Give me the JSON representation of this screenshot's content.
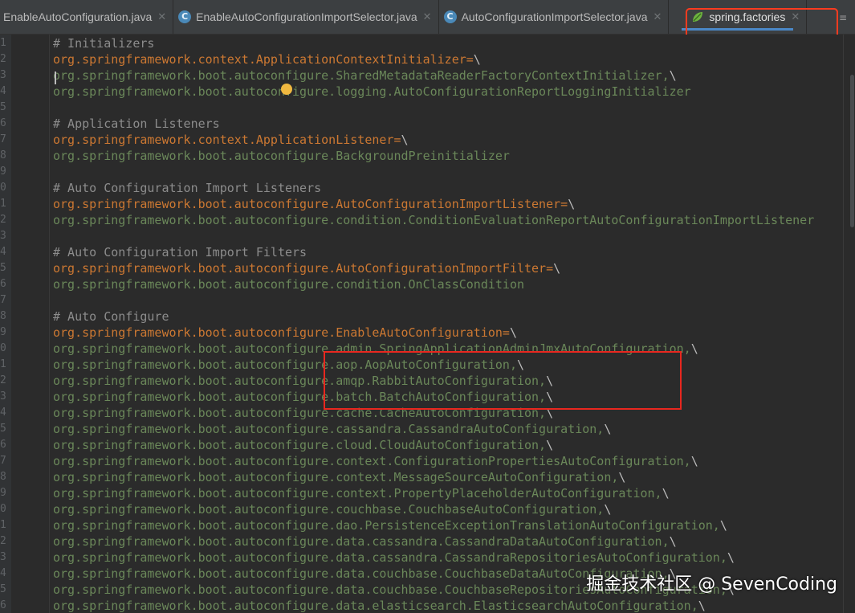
{
  "tabs": [
    {
      "label": "EnableAutoConfiguration.java",
      "icon": "java-class-icon",
      "active": false
    },
    {
      "label": "EnableAutoConfigurationImportSelector.java",
      "icon": "java-class-icon",
      "active": false
    },
    {
      "label": "AutoConfigurationImportSelector.java",
      "icon": "java-class-icon",
      "active": false
    },
    {
      "label": "spring.factories",
      "icon": "spring-leaf-icon",
      "active": true
    }
  ],
  "tab_overflow_icon": "tab-list-icon",
  "line_numbers": [
    "1",
    "2",
    "3",
    "4",
    "5",
    "6",
    "7",
    "8",
    "9",
    "0",
    "1",
    "2",
    "3",
    "4",
    "5",
    "6",
    "7",
    "8",
    "9",
    "0",
    "1",
    "2",
    "3",
    "4",
    "5",
    "6",
    "7",
    "8",
    "9",
    "0",
    "1",
    "2",
    "3",
    "4",
    "5",
    "6"
  ],
  "lines": [
    {
      "segs": [
        {
          "c": "t-comment",
          "t": "# Initializers"
        }
      ]
    },
    {
      "segs": [
        {
          "c": "t-key",
          "t": "org.springframework.context.ApplicationContextInitializer"
        },
        {
          "c": "t-eq",
          "t": "="
        },
        {
          "c": "t-bs",
          "t": "\\"
        }
      ]
    },
    {
      "segs": [
        {
          "c": "t-val",
          "t": "org.springframework.boot.autoconfigure.SharedMetadataReaderFactoryContextInitializer,"
        },
        {
          "c": "t-bs",
          "t": "\\"
        }
      ]
    },
    {
      "segs": [
        {
          "c": "t-val",
          "t": "org.springframework.boot.autoconfigure.logging.AutoConfigurationReportLoggingInitializer"
        }
      ]
    },
    {
      "segs": []
    },
    {
      "segs": [
        {
          "c": "t-comment",
          "t": "# Application Listeners"
        }
      ]
    },
    {
      "segs": [
        {
          "c": "t-key",
          "t": "org.springframework.context.ApplicationListener"
        },
        {
          "c": "t-eq",
          "t": "="
        },
        {
          "c": "t-bs",
          "t": "\\"
        }
      ]
    },
    {
      "segs": [
        {
          "c": "t-val",
          "t": "org.springframework.boot.autoconfigure.BackgroundPreinitializer"
        }
      ]
    },
    {
      "segs": []
    },
    {
      "segs": [
        {
          "c": "t-comment",
          "t": "# Auto Configuration Import Listeners"
        }
      ]
    },
    {
      "segs": [
        {
          "c": "t-key",
          "t": "org.springframework.boot.autoconfigure.AutoConfigurationImportListener"
        },
        {
          "c": "t-eq",
          "t": "="
        },
        {
          "c": "t-bs",
          "t": "\\"
        }
      ]
    },
    {
      "segs": [
        {
          "c": "t-val",
          "t": "org.springframework.boot.autoconfigure.condition.ConditionEvaluationReportAutoConfigurationImportListener"
        }
      ]
    },
    {
      "segs": []
    },
    {
      "segs": [
        {
          "c": "t-comment",
          "t": "# Auto Configuration Import Filters"
        }
      ]
    },
    {
      "segs": [
        {
          "c": "t-key",
          "t": "org.springframework.boot.autoconfigure.AutoConfigurationImportFilter"
        },
        {
          "c": "t-eq",
          "t": "="
        },
        {
          "c": "t-bs",
          "t": "\\"
        }
      ]
    },
    {
      "segs": [
        {
          "c": "t-val",
          "t": "org.springframework.boot.autoconfigure.condition.OnClassCondition"
        }
      ]
    },
    {
      "segs": []
    },
    {
      "segs": [
        {
          "c": "t-comment",
          "t": "# Auto Configure"
        }
      ]
    },
    {
      "segs": [
        {
          "c": "t-key",
          "t": "org.springframework.boot.autoconfigure.EnableAutoConfiguration"
        },
        {
          "c": "t-eq",
          "t": "="
        },
        {
          "c": "t-bs",
          "t": "\\"
        }
      ]
    },
    {
      "segs": [
        {
          "c": "t-val",
          "t": "org.springframework.boot.autoconfigure.admin.SpringApplicationAdminJmxAutoConfiguration,"
        },
        {
          "c": "t-bs",
          "t": "\\"
        }
      ]
    },
    {
      "segs": [
        {
          "c": "t-val",
          "t": "org.springframework.boot.autoconfigure.aop.AopAutoConfiguration,"
        },
        {
          "c": "t-bs",
          "t": "\\"
        }
      ]
    },
    {
      "segs": [
        {
          "c": "t-val",
          "t": "org.springframework.boot.autoconfigure.amqp.RabbitAutoConfiguration,"
        },
        {
          "c": "t-bs",
          "t": "\\"
        }
      ]
    },
    {
      "segs": [
        {
          "c": "t-val",
          "t": "org.springframework.boot.autoconfigure.batch.BatchAutoConfiguration,"
        },
        {
          "c": "t-bs",
          "t": "\\"
        }
      ]
    },
    {
      "segs": [
        {
          "c": "t-val",
          "t": "org.springframework.boot.autoconfigure.cache.CacheAutoConfiguration,"
        },
        {
          "c": "t-bs",
          "t": "\\"
        }
      ]
    },
    {
      "segs": [
        {
          "c": "t-val",
          "t": "org.springframework.boot.autoconfigure.cassandra.CassandraAutoConfiguration,"
        },
        {
          "c": "t-bs",
          "t": "\\"
        }
      ]
    },
    {
      "segs": [
        {
          "c": "t-val",
          "t": "org.springframework.boot.autoconfigure.cloud.CloudAutoConfiguration,"
        },
        {
          "c": "t-bs",
          "t": "\\"
        }
      ]
    },
    {
      "segs": [
        {
          "c": "t-val",
          "t": "org.springframework.boot.autoconfigure.context.ConfigurationPropertiesAutoConfiguration,"
        },
        {
          "c": "t-bs",
          "t": "\\"
        }
      ]
    },
    {
      "segs": [
        {
          "c": "t-val",
          "t": "org.springframework.boot.autoconfigure.context.MessageSourceAutoConfiguration,"
        },
        {
          "c": "t-bs",
          "t": "\\"
        }
      ]
    },
    {
      "segs": [
        {
          "c": "t-val",
          "t": "org.springframework.boot.autoconfigure.context.PropertyPlaceholderAutoConfiguration,"
        },
        {
          "c": "t-bs",
          "t": "\\"
        }
      ]
    },
    {
      "segs": [
        {
          "c": "t-val",
          "t": "org.springframework.boot.autoconfigure.couchbase.CouchbaseAutoConfiguration,"
        },
        {
          "c": "t-bs",
          "t": "\\"
        }
      ]
    },
    {
      "segs": [
        {
          "c": "t-val",
          "t": "org.springframework.boot.autoconfigure.dao.PersistenceExceptionTranslationAutoConfiguration,"
        },
        {
          "c": "t-bs",
          "t": "\\"
        }
      ]
    },
    {
      "segs": [
        {
          "c": "t-val",
          "t": "org.springframework.boot.autoconfigure.data.cassandra.CassandraDataAutoConfiguration,"
        },
        {
          "c": "t-bs",
          "t": "\\"
        }
      ]
    },
    {
      "segs": [
        {
          "c": "t-val",
          "t": "org.springframework.boot.autoconfigure.data.cassandra.CassandraRepositoriesAutoConfiguration,"
        },
        {
          "c": "t-bs",
          "t": "\\"
        }
      ]
    },
    {
      "segs": [
        {
          "c": "t-val",
          "t": "org.springframework.boot.autoconfigure.data.couchbase.CouchbaseDataAutoConfiguration,"
        },
        {
          "c": "t-bs",
          "t": "\\"
        }
      ]
    },
    {
      "segs": [
        {
          "c": "t-val",
          "t": "org.springframework.boot.autoconfigure.data.couchbase.CouchbaseRepositoriesAutoConfiguration,"
        },
        {
          "c": "t-bs",
          "t": "\\"
        }
      ]
    },
    {
      "segs": [
        {
          "c": "t-val",
          "t": "org.springframework.boot.autoconfigure.data.elasticsearch.ElasticsearchAutoConfiguration,"
        },
        {
          "c": "t-bs",
          "t": "\\"
        }
      ]
    }
  ],
  "watermark": "掘金技术社区 @ SevenCoding"
}
